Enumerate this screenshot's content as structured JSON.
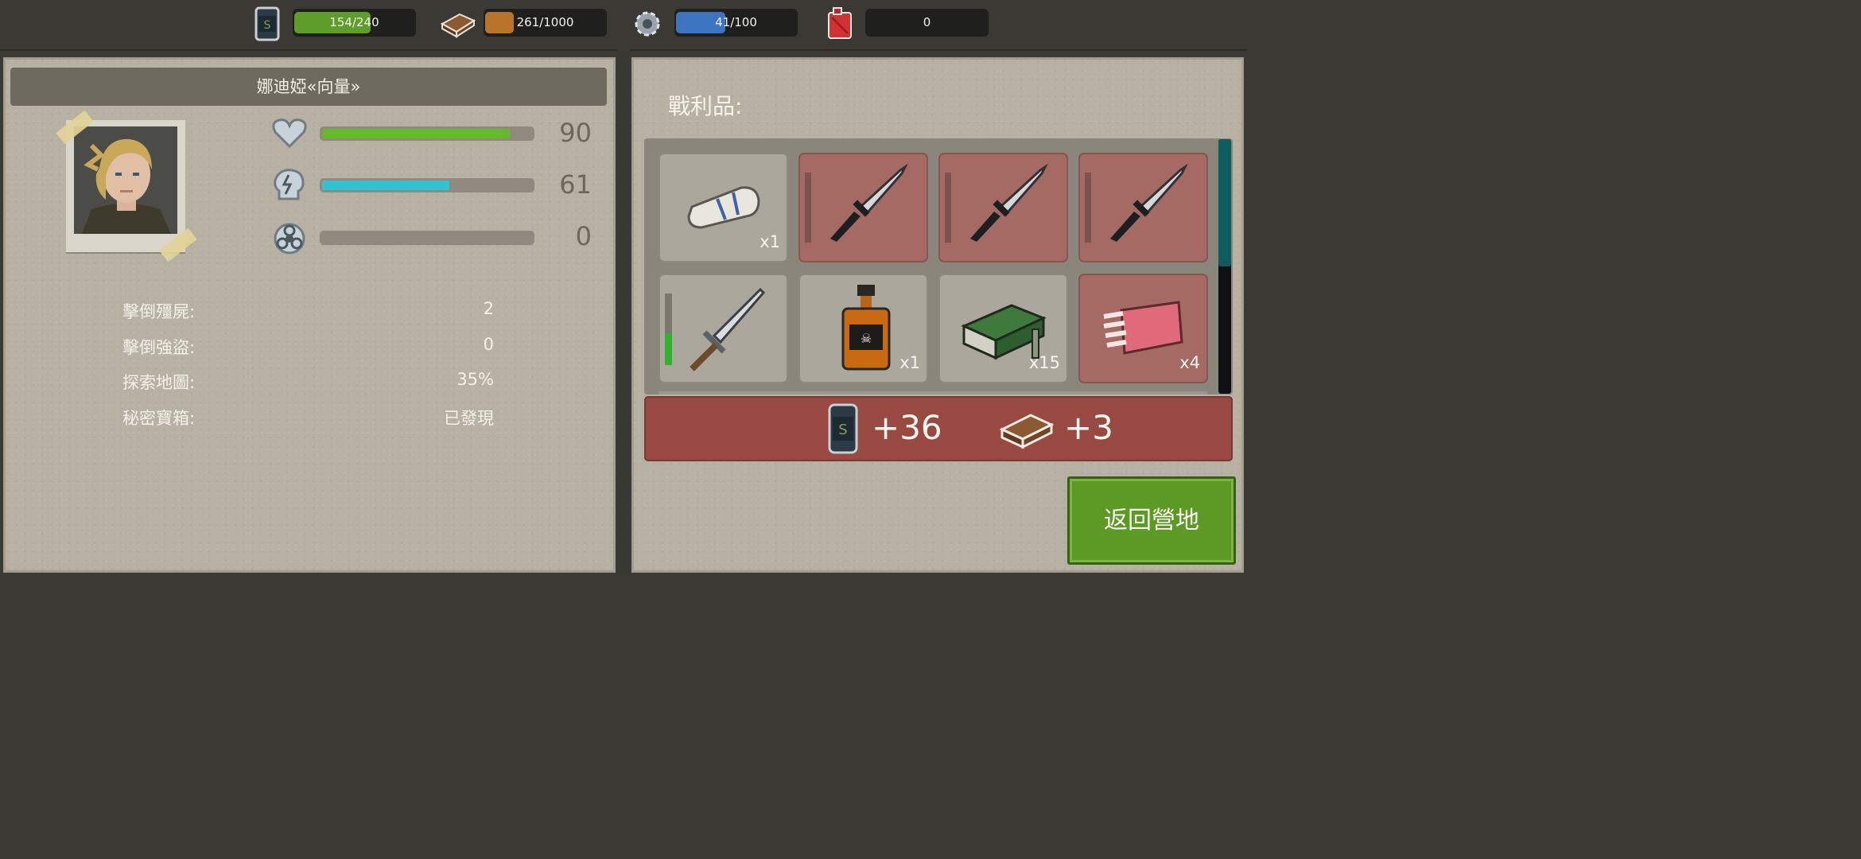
{
  "resources": [
    {
      "icon": "canned-food-icon",
      "text": "154/240",
      "fill": 0.64,
      "color": "#5f9d2a"
    },
    {
      "icon": "wood-plank-icon",
      "text": "261/1000",
      "fill": 0.26,
      "color": "#b7742a"
    },
    {
      "icon": "gear-icon",
      "text": "41/100",
      "fill": 0.41,
      "color": "#3c74c0"
    },
    {
      "icon": "fuel-can-icon",
      "text": "0",
      "fill": 0,
      "color": "#444444"
    }
  ],
  "character": {
    "name": "娜迪婭«向量»",
    "stats": [
      {
        "icon": "health-heart-icon",
        "value": "90",
        "fill": 0.9,
        "color": "#66b82c"
      },
      {
        "icon": "energy-head-icon",
        "value": "61",
        "fill": 0.61,
        "color": "#2fc3d4"
      },
      {
        "icon": "biohazard-icon",
        "value": "0",
        "fill": 0,
        "color": "#7d7466"
      }
    ],
    "info": [
      {
        "label": "擊倒殭屍:",
        "value": "2"
      },
      {
        "label": "擊倒強盜:",
        "value": "0"
      },
      {
        "label": "探索地圖:",
        "value": "35%"
      },
      {
        "label": "秘密寶箱:",
        "value": "已發現"
      }
    ]
  },
  "loot": {
    "title": "戰利品:",
    "items": [
      {
        "icon": "bandage-roll-icon",
        "count": "x1",
        "style": "gray"
      },
      {
        "icon": "combat-knife-icon",
        "count": "",
        "style": "red"
      },
      {
        "icon": "combat-knife-icon",
        "count": "",
        "style": "red"
      },
      {
        "icon": "combat-knife-icon",
        "count": "",
        "style": "red"
      },
      {
        "icon": "sword-icon",
        "count": "",
        "style": "gray",
        "durability": 0.45
      },
      {
        "icon": "whiskey-bottle-icon",
        "count": "x1",
        "style": "gray"
      },
      {
        "icon": "ammo-box-icon",
        "count": "x15",
        "style": "gray"
      },
      {
        "icon": "raw-meat-icon",
        "count": "x4",
        "style": "red"
      }
    ],
    "rewards": [
      {
        "icon": "canned-food-icon",
        "value": "+36"
      },
      {
        "icon": "wood-plank-icon",
        "value": "+3"
      }
    ]
  },
  "return_button": "返回營地"
}
